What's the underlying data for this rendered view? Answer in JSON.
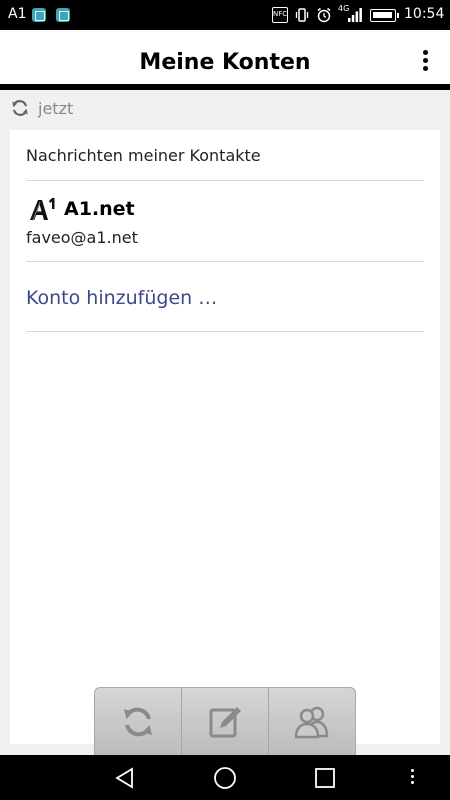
{
  "status_bar": {
    "carrier": "A1",
    "nfc": "NFC",
    "network": "4G",
    "time": "10:54",
    "icons": [
      "app-notification-icon",
      "image-notification-icon",
      "nfc-icon",
      "vibrate-icon",
      "alarm-icon",
      "signal-icon",
      "battery-icon"
    ]
  },
  "app_bar": {
    "title": "Meine Konten",
    "menu_icon": "overflow-menu-icon"
  },
  "sync": {
    "icon": "sync-icon",
    "time": "jetzt"
  },
  "accounts": {
    "contacts_label": "Nachrichten meiner Kontakte",
    "items": [
      {
        "logo": "A1",
        "name": "A1.net",
        "email": "faveo@a1.net"
      }
    ],
    "add_account": "Konto hinzufügen …"
  },
  "action_bar": {
    "buttons": [
      "refresh-icon",
      "compose-icon",
      "contacts-icon"
    ]
  },
  "nav_bar": {
    "buttons": [
      "back-icon",
      "home-icon",
      "recents-icon",
      "more-icon"
    ]
  },
  "colors": {
    "link": "#3b4a8a",
    "muted": "#888888",
    "background": "#f0f0f0",
    "notification": "#3da8b5"
  }
}
